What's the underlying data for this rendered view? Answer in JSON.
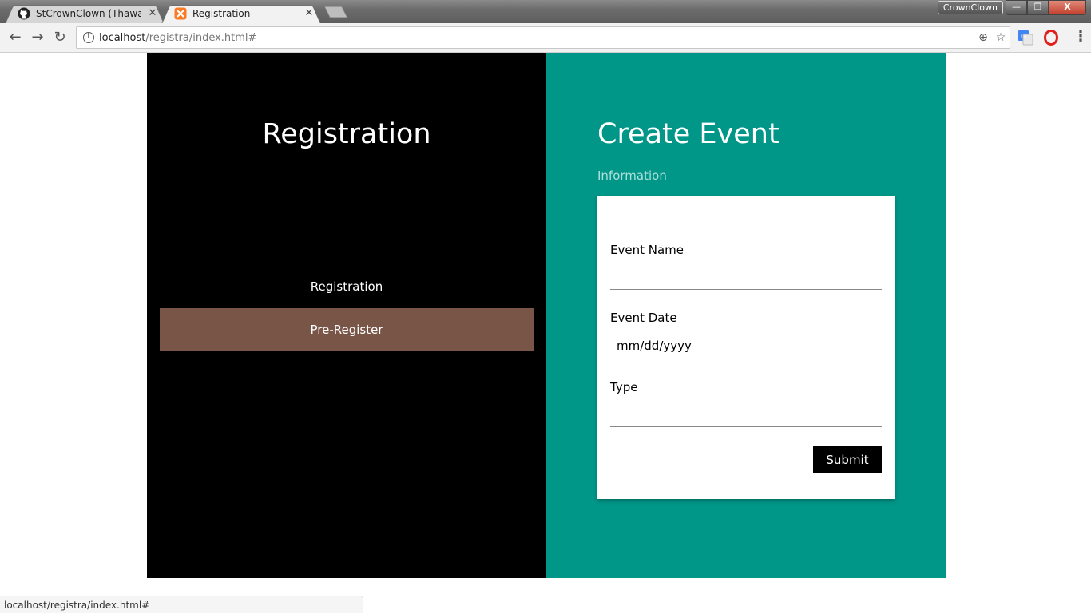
{
  "browser": {
    "tabs": [
      {
        "title": "StCrownClown (Thawatch",
        "favicon": "github-icon",
        "close": "✕"
      },
      {
        "title": "Registration",
        "favicon": "xampp-icon",
        "close": "✕"
      }
    ],
    "profile_name": "CrownClown",
    "window_controls": {
      "minimize": "—",
      "maximize": "❐",
      "close": "X"
    },
    "url_host": "localhost",
    "url_path": "/registra/index.html#",
    "status_url": "localhost/registra/index.html#"
  },
  "left_panel": {
    "title": "Registration",
    "menu": [
      {
        "label": "Registration"
      },
      {
        "label": "Pre-Register"
      }
    ]
  },
  "right_panel": {
    "title": "Create Event",
    "subtitle": "Information",
    "form": {
      "event_name": {
        "label": "Event Name",
        "value": ""
      },
      "event_date": {
        "label": "Event Date",
        "value": "mm/dd/yyyy"
      },
      "type": {
        "label": "Type",
        "value": ""
      },
      "submit_label": "Submit"
    }
  },
  "colors": {
    "left_panel_bg": "#000000",
    "right_panel_bg": "#009688",
    "active_menu_bg": "#795548",
    "subtitle_color": "#b2dfdb"
  }
}
